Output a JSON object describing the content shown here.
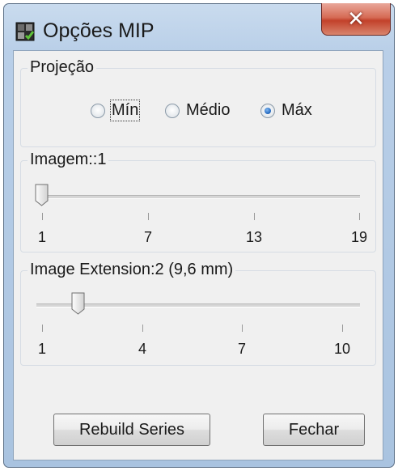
{
  "window": {
    "title": "Opções MIP",
    "close_glyph": "✕"
  },
  "projection": {
    "title": "Projeção",
    "options": [
      {
        "label": "Mín",
        "checked": false
      },
      {
        "label": "Médio",
        "checked": false
      },
      {
        "label": "Máx",
        "checked": true
      }
    ]
  },
  "image_slider": {
    "title": "Imagem::1",
    "min": 1,
    "max": 19,
    "value": 1,
    "ticks": [
      "1",
      "7",
      "13",
      "19"
    ]
  },
  "extension_slider": {
    "title": "Image Extension:2 (9,6 mm)",
    "min": 1,
    "max": 10,
    "value": 2,
    "ticks": [
      "1",
      "4",
      "7",
      "10"
    ]
  },
  "buttons": {
    "rebuild_label": "Rebuild Series",
    "close_label": "Fechar"
  },
  "colors": {
    "accent": "#2a6fc4",
    "close_button": "#c2412a"
  }
}
